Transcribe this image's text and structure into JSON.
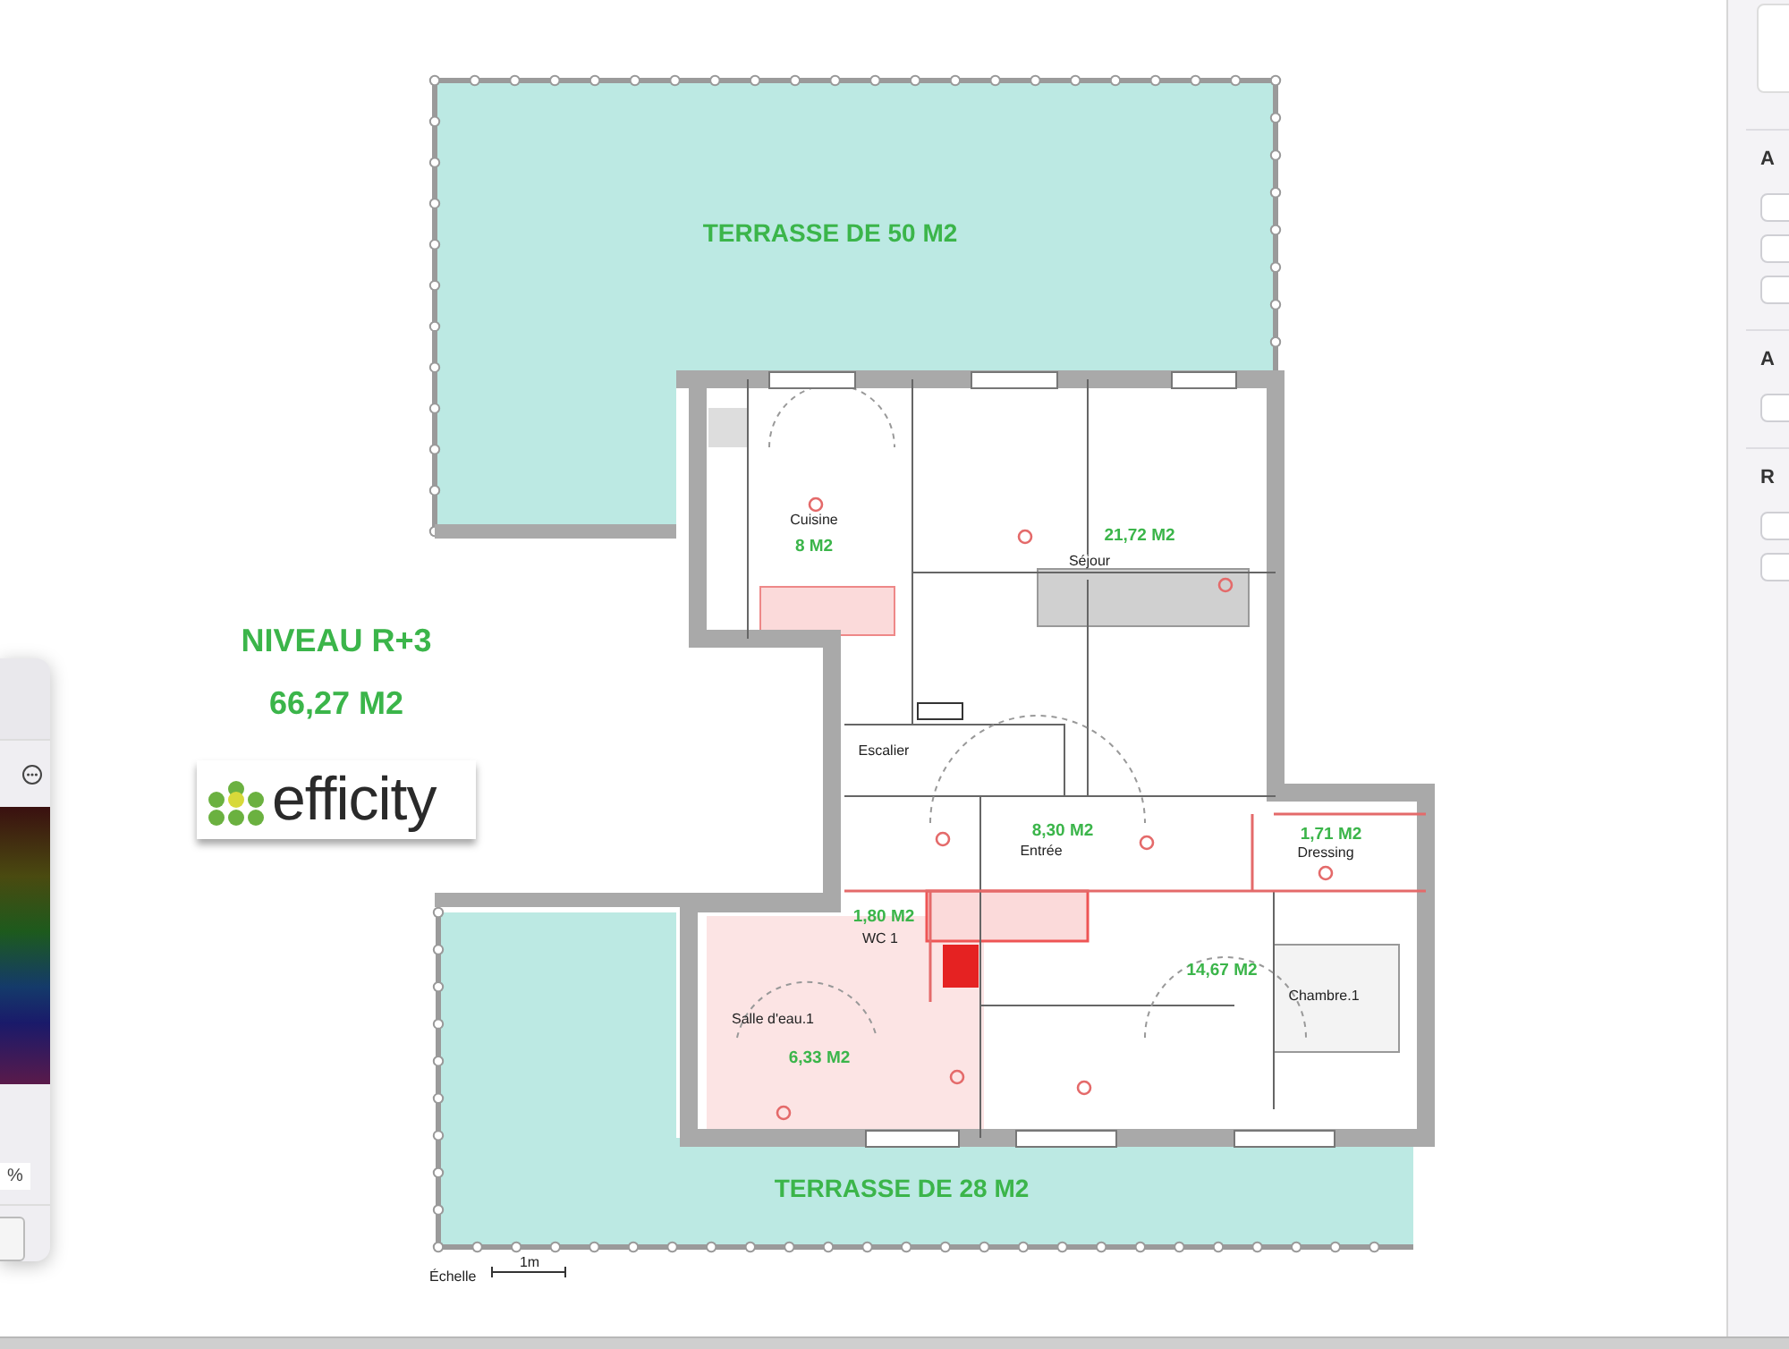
{
  "canvas": {
    "plan": {
      "terraces": [
        {
          "label": "TERRASSE DE 50 M2"
        },
        {
          "label": "TERRASSE DE 28 M2"
        }
      ],
      "level_title": "NIVEAU R+3",
      "total_area": "66,27 M2",
      "rooms": [
        {
          "name": "Cuisine",
          "area": "8 M2"
        },
        {
          "name": "Séjour",
          "area": "21,72 M2"
        },
        {
          "name": "Escalier"
        },
        {
          "name": "Entrée",
          "area": "8,30 M2"
        },
        {
          "name": "Dressing",
          "area": "1,71 M2"
        },
        {
          "name": "WC 1",
          "area": "1,80 M2"
        },
        {
          "name": "Chambre.1",
          "area": "14,67 M2"
        },
        {
          "name": "Salle d'eau.1",
          "area": "6,33 M2"
        }
      ],
      "scale": {
        "label": "Échelle",
        "unit": "1m"
      }
    },
    "logo": {
      "text": "efficity"
    }
  },
  "color_panel": {
    "opacity_unit": "%"
  },
  "inspector": {
    "sections": [
      {
        "heading": "A",
        "fields": [
          {
            "kind": "field"
          },
          {
            "kind": "field"
          },
          {
            "kind": "field"
          }
        ]
      },
      {
        "heading": "A",
        "fields": [
          {
            "kind": "field"
          }
        ]
      },
      {
        "heading": "R",
        "fields": [
          {
            "kind": "field"
          },
          {
            "kind": "field"
          }
        ]
      }
    ]
  }
}
